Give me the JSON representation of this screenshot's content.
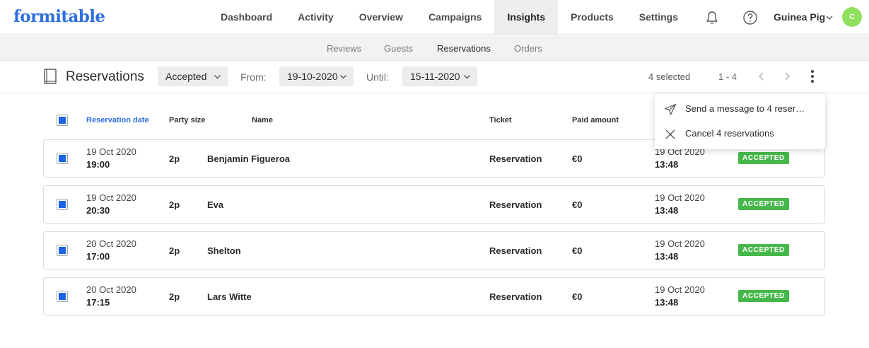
{
  "app": {
    "logo": "formitable"
  },
  "nav": {
    "tabs": [
      "Dashboard",
      "Activity",
      "Overview",
      "Campaigns",
      "Insights",
      "Products",
      "Settings"
    ],
    "active": "Insights"
  },
  "user": {
    "name": "Guinea Pig",
    "initial": "C"
  },
  "subnav": {
    "tabs": [
      "Reviews",
      "Guests",
      "Reservations",
      "Orders"
    ],
    "active": "Reservations"
  },
  "toolbar": {
    "title": "Reservations",
    "status_filter": "Accepted",
    "from_label": "From:",
    "from_value": "19-10-2020",
    "until_label": "Until:",
    "until_value": "15-11-2020",
    "selected": "4 selected",
    "range": "1 - 4"
  },
  "table": {
    "headers": {
      "date": "Reservation date",
      "party": "Party size",
      "name": "Name",
      "ticket": "Ticket",
      "paid": "Paid amount"
    },
    "rows": [
      {
        "date": "19 Oct 2020",
        "time": "19:00",
        "party": "2p",
        "name": "Benjamin Figueroa",
        "ticket": "Reservation",
        "paid": "€0",
        "created_date": "19 Oct 2020",
        "created_time": "13:48",
        "status": "ACCEPTED"
      },
      {
        "date": "19 Oct 2020",
        "time": "20:30",
        "party": "2p",
        "name": "Eva",
        "ticket": "Reservation",
        "paid": "€0",
        "created_date": "19 Oct 2020",
        "created_time": "13:48",
        "status": "ACCEPTED"
      },
      {
        "date": "20 Oct 2020",
        "time": "17:00",
        "party": "2p",
        "name": "Shelton",
        "ticket": "Reservation",
        "paid": "€0",
        "created_date": "19 Oct 2020",
        "created_time": "13:48",
        "status": "ACCEPTED"
      },
      {
        "date": "20 Oct 2020",
        "time": "17:15",
        "party": "2p",
        "name": "Lars Witte",
        "ticket": "Reservation",
        "paid": "€0",
        "created_date": "19 Oct 2020",
        "created_time": "13:48",
        "status": "ACCEPTED"
      }
    ]
  },
  "menu": {
    "send_message": "Send a message to 4 reser…",
    "cancel": "Cancel 4 reservations"
  },
  "colors": {
    "brand": "#2f6fe0",
    "accepted": "#46b84b",
    "checkbox": "#1c63e8",
    "avatar": "#8fe05a"
  }
}
